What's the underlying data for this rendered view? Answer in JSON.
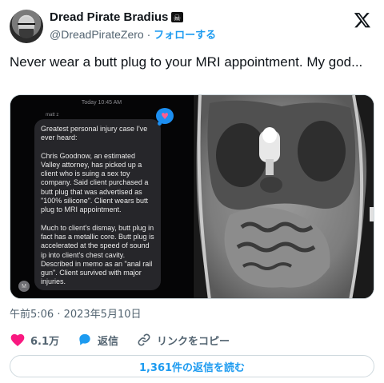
{
  "author": {
    "display_name": "Dread Pirate Bradius",
    "handle": "@DreadPirateZero",
    "separator": "·",
    "follow_label": "フォローする"
  },
  "tweet": {
    "text": "Never wear a butt plug to your MRI appointment. My god...",
    "timestamp": "午前5:06 · 2023年5月10日"
  },
  "message_screenshot": {
    "time_header": "Today 10:45 AM",
    "sender": "matt z",
    "paragraphs": [
      "Greatest personal injury case I've ever heard:",
      "Chris Goodnow, an estimated Valley attorney, has picked up a client who is suing a sex toy company. Said client purchased a butt plug that was advertised as \"100% silicone\". Client wears butt plug to MRI appointment.",
      "Much to client's dismay, butt plug in fact has a metallic core. Butt plug is accelerated at the speed of sound ip into client's chest cavity. Described in memo as an \"anal rail gun\". Client survived with major injuries."
    ],
    "avatar_initial": "M",
    "reaction_icon": "heart-icon"
  },
  "actions": {
    "like_count": "6.1万",
    "reply_label": "返信",
    "copy_link_label": "リンクをコピー"
  },
  "read_replies_label": "1,361件の返信を読む",
  "colors": {
    "accent": "#1d9bf0",
    "like": "#f91880",
    "secondary_text": "#536471"
  }
}
